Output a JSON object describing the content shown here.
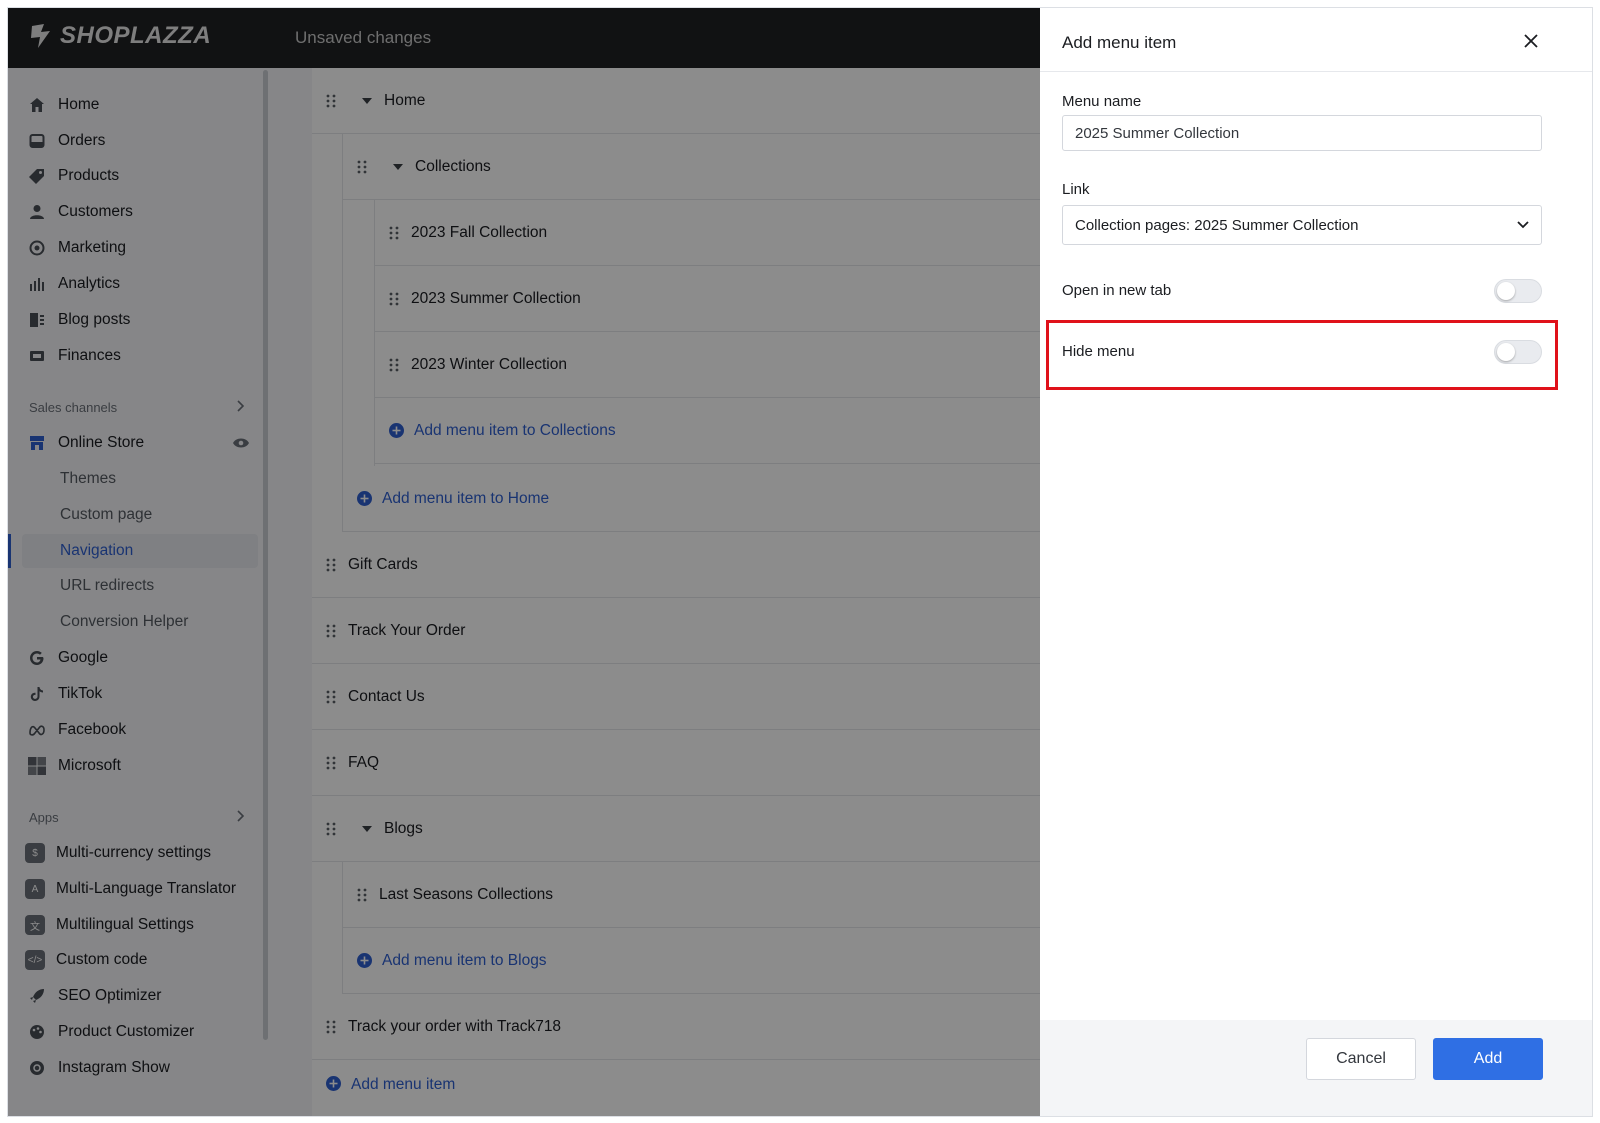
{
  "topbar": {
    "logo_text": "SHOPLAZZA",
    "status": "Unsaved changes"
  },
  "sidebar": {
    "main_items": [
      {
        "label": "Home",
        "icon": "home-icon"
      },
      {
        "label": "Orders",
        "icon": "orders-icon"
      },
      {
        "label": "Products",
        "icon": "tag-icon"
      },
      {
        "label": "Customers",
        "icon": "person-icon"
      },
      {
        "label": "Marketing",
        "icon": "marketing-icon"
      },
      {
        "label": "Analytics",
        "icon": "bar-chart-icon"
      },
      {
        "label": "Blog posts",
        "icon": "blog-icon"
      },
      {
        "label": "Finances",
        "icon": "finances-icon"
      }
    ],
    "sales_channels_label": "Sales channels",
    "online_store": {
      "label": "Online Store",
      "icon": "store-icon"
    },
    "online_store_subitems": [
      "Themes",
      "Custom page",
      "Navigation",
      "URL redirects",
      "Conversion Helper"
    ],
    "active_subitem": "Navigation",
    "channels": [
      {
        "label": "Google",
        "icon": "google-icon"
      },
      {
        "label": "TikTok",
        "icon": "tiktok-icon"
      },
      {
        "label": "Facebook",
        "icon": "meta-icon"
      },
      {
        "label": "Microsoft",
        "icon": "microsoft-icon"
      }
    ],
    "apps_label": "Apps",
    "apps": [
      {
        "label": "Multi-currency settings"
      },
      {
        "label": "Multi-Language Translator"
      },
      {
        "label": "Multilingual Settings"
      },
      {
        "label": "Custom code"
      },
      {
        "label": "SEO Optimizer"
      },
      {
        "label": "Product Customizer"
      },
      {
        "label": "Instagram Show"
      }
    ]
  },
  "menu_tree": {
    "home": "Home",
    "collections": "Collections",
    "collection_items": [
      "2023 Fall Collection",
      "2023 Summer Collection",
      "2023 Winter Collection"
    ],
    "add_to_collections": "Add menu item to Collections",
    "add_to_home": "Add menu item to Home",
    "top_items": [
      "Gift Cards",
      "Track Your Order",
      "Contact Us",
      "FAQ"
    ],
    "blogs": "Blogs",
    "blog_items": [
      "Last Seasons Collections"
    ],
    "add_to_blogs": "Add menu item to Blogs",
    "track718": "Track your order with Track718",
    "add_menu_item": "Add menu item"
  },
  "drawer": {
    "title": "Add menu item",
    "menu_name_label": "Menu name",
    "menu_name_value": "2025 Summer Collection",
    "link_label": "Link",
    "link_value": "Collection pages: 2025 Summer Collection",
    "open_new_tab_label": "Open in new tab",
    "open_new_tab_on": false,
    "hide_menu_label": "Hide menu",
    "hide_menu_on": false,
    "cancel_label": "Cancel",
    "add_label": "Add"
  },
  "colors": {
    "accent": "#2f6fe4",
    "highlight": "#e0111a",
    "topbar": "#1f2124"
  }
}
